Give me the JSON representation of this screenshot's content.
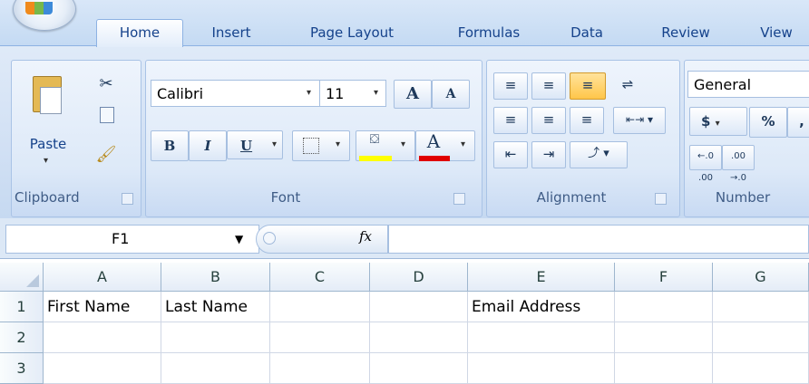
{
  "tabs": [
    "Home",
    "Insert",
    "Page Layout",
    "Formulas",
    "Data",
    "Review",
    "View"
  ],
  "active_tab": "Home",
  "clipboard": {
    "paste_label": "Paste",
    "group_label": "Clipboard"
  },
  "font": {
    "name": "Calibri",
    "size": "11",
    "group_label": "Font",
    "bold": "B",
    "italic": "I",
    "underline": "U",
    "grow": "A",
    "shrink": "A",
    "font_color_glyph": "A",
    "highlight_color": "#ffff00",
    "font_color": "#e00000"
  },
  "alignment": {
    "group_label": "Alignment"
  },
  "number": {
    "format": "General",
    "group_label": "Number",
    "currency": "$",
    "percent": "%",
    "comma": ",",
    "inc_decimal": "←.0 .00",
    "dec_decimal": ".00 →.0"
  },
  "formula_bar": {
    "name_box": "F1",
    "fx": "fx",
    "value": ""
  },
  "grid": {
    "columns": [
      "A",
      "B",
      "C",
      "D",
      "E",
      "F",
      "G"
    ],
    "rows": [
      {
        "num": "1",
        "cells": [
          "First Name",
          "Last Name",
          "",
          "",
          "Email Address",
          "",
          ""
        ]
      },
      {
        "num": "2",
        "cells": [
          "",
          "",
          "",
          "",
          "",
          "",
          ""
        ]
      },
      {
        "num": "3",
        "cells": [
          "",
          "",
          "",
          "",
          "",
          "",
          ""
        ]
      }
    ]
  }
}
